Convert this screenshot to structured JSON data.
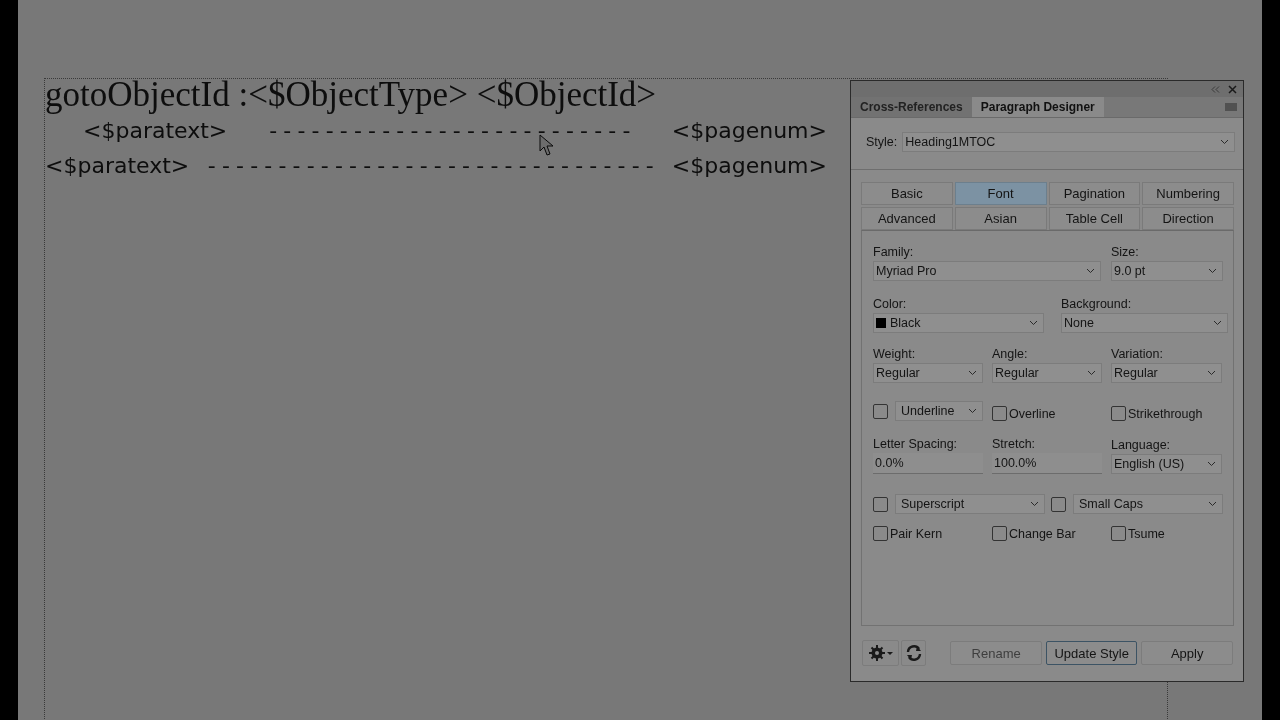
{
  "document": {
    "lines": [
      {
        "kind": "heading",
        "text": "gotoObjectId :<$ObjectType> <$ObjectId>"
      },
      {
        "kind": "toc-indented",
        "paratext": "<$paratext>",
        "leader": "- - - - - - - - - - - - - - - - - - - - - - - - - -",
        "pagenum": "<$pagenum>"
      },
      {
        "kind": "toc",
        "paratext": "<$paratext>",
        "leader": "- - - - - - - - - - - - - - - - - - - - - - - - - - - - - - - -",
        "pagenum": "<$pagenum>"
      }
    ]
  },
  "panel": {
    "tabs": [
      {
        "label": "Cross-References",
        "selected": false
      },
      {
        "label": "Paragraph Designer",
        "selected": true
      }
    ],
    "style": {
      "label": "Style:",
      "value": "Heading1MTOC"
    },
    "subtabs": [
      {
        "label": "Basic",
        "selected": false
      },
      {
        "label": "Font",
        "selected": true
      },
      {
        "label": "Pagination",
        "selected": false
      },
      {
        "label": "Numbering",
        "selected": false
      },
      {
        "label": "Advanced",
        "selected": false
      },
      {
        "label": "Asian",
        "selected": false
      },
      {
        "label": "Table Cell",
        "selected": false
      },
      {
        "label": "Direction",
        "selected": false
      }
    ],
    "rows": [
      {
        "fields": [
          {
            "kind": "dropdown",
            "label": "Family:",
            "value": "Myriad Pro"
          },
          {
            "kind": "dropdown",
            "label": "Size:",
            "value": "9.0 pt"
          }
        ]
      },
      {
        "fields": [
          {
            "kind": "dropdown",
            "label": "Color:",
            "value": "Black",
            "color": "#000000"
          },
          {
            "kind": "dropdown",
            "label": "Background:",
            "value": "None"
          }
        ]
      },
      {
        "fields": [
          {
            "kind": "dropdown",
            "label": "Weight:",
            "value": "Regular"
          },
          {
            "kind": "dropdown",
            "label": "Angle:",
            "value": "Regular"
          },
          {
            "kind": "dropdown",
            "label": "Variation:",
            "value": "Regular"
          }
        ]
      },
      {
        "fields": [
          {
            "kind": "checkdrop",
            "value": "Underline",
            "checked": false
          },
          {
            "kind": "check",
            "label": "Overline",
            "checked": false
          },
          {
            "kind": "check",
            "label": "Strikethrough",
            "checked": false
          }
        ]
      },
      {
        "fields": [
          {
            "kind": "text",
            "label": "Letter Spacing:",
            "value": "0.0%"
          },
          {
            "kind": "text",
            "label": "Stretch:",
            "value": "100.0%"
          },
          {
            "kind": "dropdown",
            "label": "Language:",
            "value": "English (US)"
          }
        ]
      },
      {
        "fields": [
          {
            "kind": "checkdrop",
            "value": "Superscript",
            "checked": false
          },
          {
            "kind": "checkdrop",
            "value": "Small Caps",
            "checked": false
          }
        ]
      },
      {
        "fields": [
          {
            "kind": "check",
            "label": "Pair Kern",
            "checked": false
          },
          {
            "kind": "check",
            "label": "Change Bar",
            "checked": false
          },
          {
            "kind": "check",
            "label": "Tsume",
            "checked": false
          }
        ]
      }
    ],
    "buttons": [
      {
        "label": "Rename",
        "disabled": true,
        "focused": false
      },
      {
        "label": "Update Style",
        "disabled": false,
        "focused": true
      },
      {
        "label": "Apply",
        "disabled": false,
        "focused": false
      }
    ]
  }
}
